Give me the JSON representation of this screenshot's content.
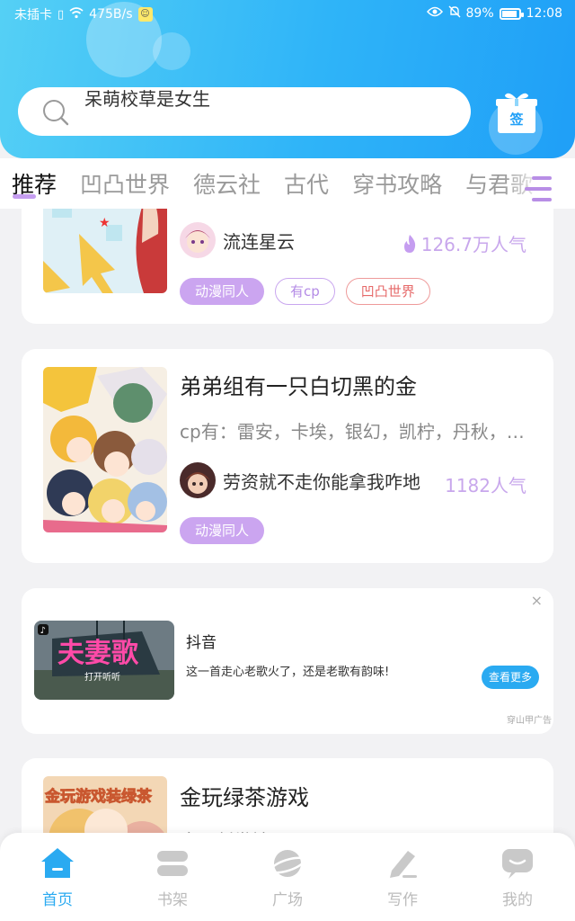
{
  "status_bar": {
    "carrier": "未插卡",
    "speed": "475B/s",
    "battery": "89%",
    "time": "12:08"
  },
  "search": {
    "query": "呆萌校草是女生"
  },
  "checkin": {
    "label": "签"
  },
  "tabs": [
    {
      "label": "推荐",
      "active": true
    },
    {
      "label": "凹凸世界",
      "active": false
    },
    {
      "label": "德云社",
      "active": false
    },
    {
      "label": "古代",
      "active": false
    },
    {
      "label": "穿书攻略",
      "active": false
    },
    {
      "label": "与君歌",
      "active": false
    }
  ],
  "books": [
    {
      "author": "流连星云",
      "popularity": "126.7万人气",
      "tags": [
        "动漫同人",
        "有cp",
        "凹凸世界"
      ]
    },
    {
      "title": "弟弟组有一只白切黑的金",
      "description": "cp有：雷安，卡埃，银幻，凯柠，丹秋，…",
      "author": "劳资就不走你能拿我咋地",
      "popularity": "1182人气",
      "tags": [
        "动漫同人"
      ]
    },
    {
      "title": "金玩绿茶游戏",
      "cover_text": "金玩游戏装绿茶",
      "description": "金风创世神"
    }
  ],
  "ad": {
    "app_name": "抖音",
    "text": "这一首走心老歌火了，还是老歌有韵味!",
    "button": "查看更多",
    "image_title": "夫妻歌",
    "image_subtitle": "打开听听",
    "source": "穿山甲广告",
    "close": "×"
  },
  "bottom_nav": [
    {
      "label": "首页",
      "active": true
    },
    {
      "label": "书架",
      "active": false
    },
    {
      "label": "广场",
      "active": false
    },
    {
      "label": "写作",
      "active": false
    },
    {
      "label": "我的",
      "active": false
    }
  ],
  "colors": {
    "primary": "#2aaaf1",
    "accent_purple": "#cba5f0"
  }
}
